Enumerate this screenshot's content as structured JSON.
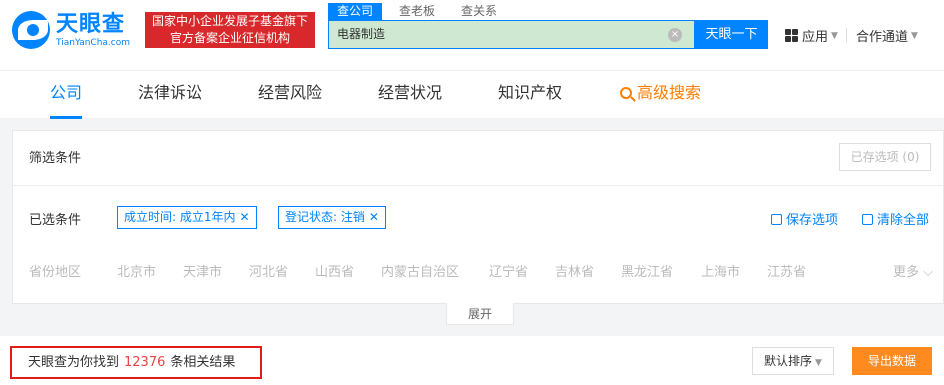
{
  "header": {
    "logo_cn": "天眼查",
    "logo_en": "TianYanCha.com",
    "promo_line1": "国家中小企业发展子基金旗下",
    "promo_line2": "官方备案企业征信机构",
    "search_tabs": [
      "查公司",
      "查老板",
      "查关系"
    ],
    "search_value": "电器制造",
    "search_button": "天眼一下",
    "apps_label": "应用",
    "partner_label": "合作通道"
  },
  "nav": {
    "tabs": [
      "公司",
      "法律诉讼",
      "经营风险",
      "经营状况",
      "知识产权"
    ],
    "advanced_search": "高级搜索"
  },
  "filter": {
    "title": "筛选条件",
    "saved_options": "已存选项 (0)",
    "selected_label": "已选条件",
    "chips": [
      "成立时间: 成立1年内",
      "登记状态: 注销"
    ],
    "save_option": "保存选项",
    "clear_all": "清除全部",
    "province_label": "省份地区",
    "provinces": [
      "北京市",
      "天津市",
      "河北省",
      "山西省",
      "内蒙古自治区",
      "辽宁省",
      "吉林省",
      "黑龙江省",
      "上海市",
      "江苏省"
    ],
    "more": "更多",
    "expand": "展开"
  },
  "results": {
    "prefix": "天眼查为你找到",
    "count": "12376",
    "suffix": "条相关结果",
    "sort_label": "默认排序",
    "export_label": "导出数据"
  },
  "colors": {
    "brand": "#0084ff",
    "accent_orange": "#ff8a1f",
    "highlight_red": "#e21b1b"
  }
}
